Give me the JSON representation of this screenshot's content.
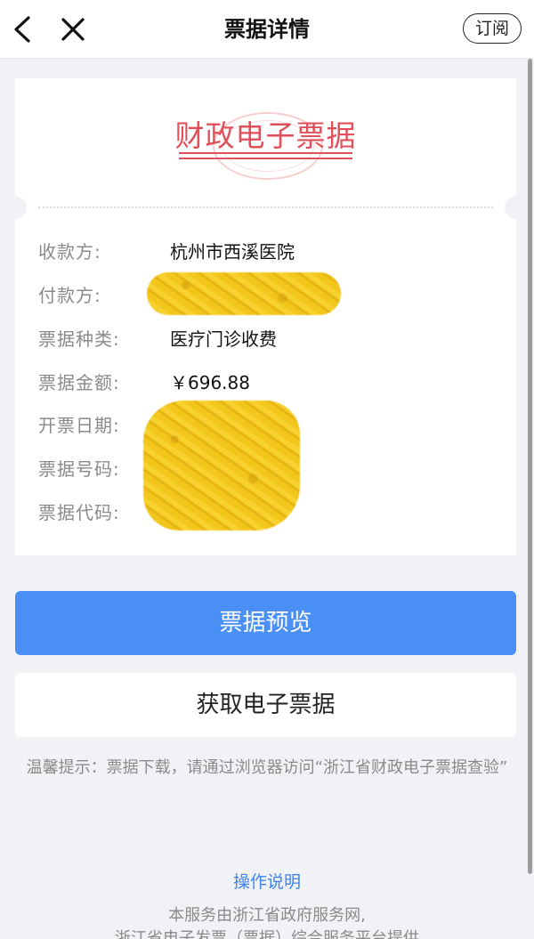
{
  "header": {
    "title": "票据详情",
    "subscribe_label": "订阅",
    "back_icon": "chevron-left-icon",
    "close_icon": "close-icon"
  },
  "receipt": {
    "title": "财政电子票据",
    "title_color": "#e0505a",
    "fields": [
      {
        "label": "收款方:",
        "value": "杭州市西溪医院"
      },
      {
        "label": "付款方:",
        "value": ""
      },
      {
        "label": "票据种类:",
        "value": "医疗门诊收费"
      },
      {
        "label": "票据金额:",
        "value": "￥696.88"
      },
      {
        "label": "开票日期:",
        "value": ""
      },
      {
        "label": "票据号码:",
        "value": ""
      },
      {
        "label": "票据代码:",
        "value": ""
      }
    ]
  },
  "actions": {
    "preview_label": "票据预览",
    "preview_color": "#4a8ff5",
    "get_receipt_label": "获取电子票据"
  },
  "footer": {
    "tip": "温馨提示：票据下载，请通过浏览器访问“浙江省财政电子票据查验”",
    "instructions_link": "操作说明",
    "service_line_1": "本服务由浙江省政府服务网,",
    "service_line_2": "浙江省电子发票（票据）综合服务平台提供"
  }
}
